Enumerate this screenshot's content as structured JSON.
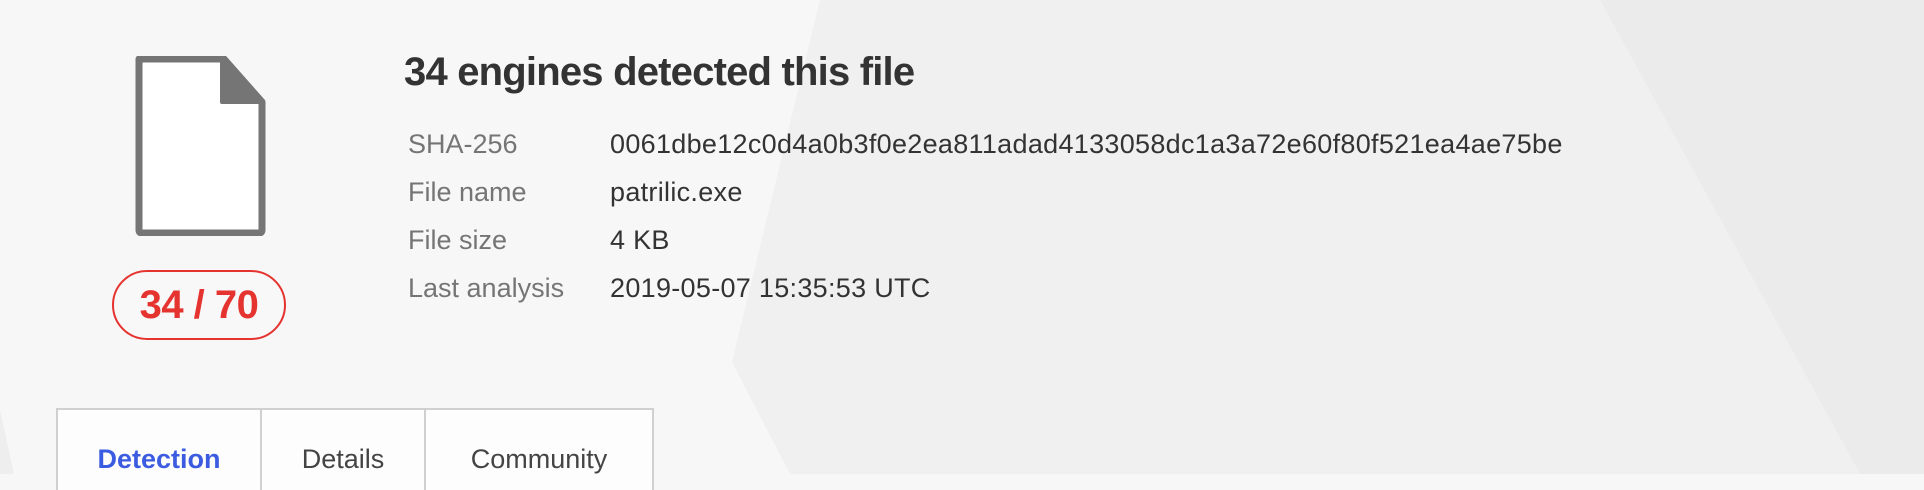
{
  "report": {
    "title": "34 engines detected this file",
    "score": "34 / 70",
    "score_color": "#e5332f",
    "detections": 34,
    "total_engines": 70,
    "file_icon": "generic-document-icon"
  },
  "info": [
    {
      "label": "SHA-256",
      "value": "0061dbe12c0d4a0b3f0e2ea811adad4133058dc1a3a72e60f80f521ea4ae75be"
    },
    {
      "label": "File name",
      "value": "patrilic.exe"
    },
    {
      "label": "File size",
      "value": "4 KB"
    },
    {
      "label": "Last analysis",
      "value": "2019-05-07 15:35:53 UTC"
    }
  ],
  "tabs": [
    {
      "label": "Detection",
      "active": true
    },
    {
      "label": "Details",
      "active": false
    },
    {
      "label": "Community",
      "active": false
    }
  ],
  "colors": {
    "accent": "#3b5be0",
    "danger": "#e5332f"
  }
}
